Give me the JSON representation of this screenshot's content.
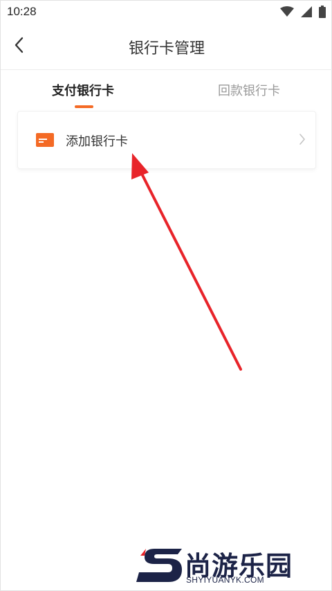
{
  "status_bar": {
    "time": "10:28",
    "icons": [
      "wifi-icon",
      "signal-icon",
      "battery-icon"
    ]
  },
  "header": {
    "back_icon": "chevron-left-icon",
    "title": "银行卡管理"
  },
  "tabs": [
    {
      "label": "支付银行卡",
      "active": true
    },
    {
      "label": "回款银行卡",
      "active": false
    }
  ],
  "card_list": {
    "add_card": {
      "icon": "bank-card-icon",
      "label": "添加银行卡",
      "chevron": "chevron-right-icon"
    }
  },
  "annotation": {
    "arrow_color": "#e8242a"
  },
  "watermark": {
    "brand_cn": "尚游乐园",
    "brand_en": "SHYIYUANYK.COM"
  },
  "colors": {
    "accent": "#f46a25",
    "tab_inactive": "#999999",
    "text_primary": "#333333"
  }
}
